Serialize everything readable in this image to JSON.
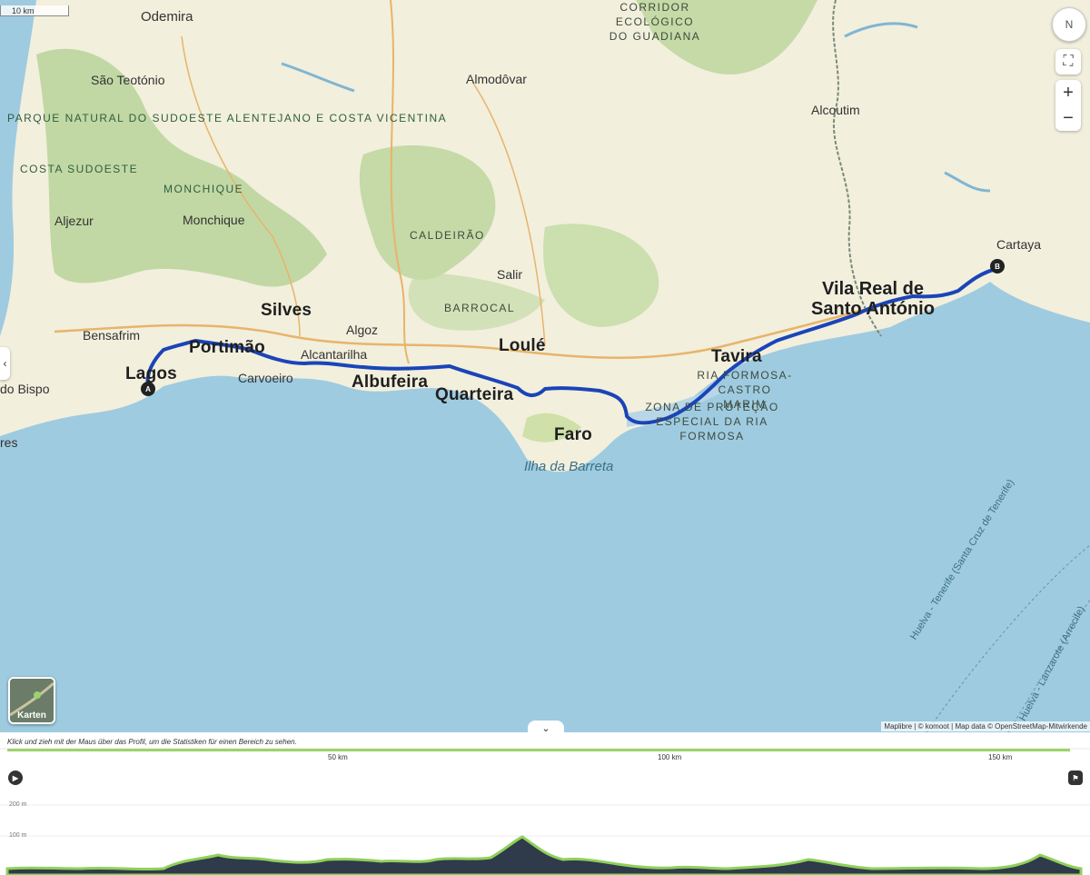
{
  "map": {
    "scale_label": "10 km",
    "compass_label": "N",
    "locate_icon": "locate-icon",
    "zoom_in_label": "+",
    "zoom_out_label": "−",
    "side_toggle_label": "‹",
    "layers_label": "Karten",
    "collapse_label": "⌄",
    "attribution": "Maplibre | © komoot | Map data © OpenStreetMap-Mitwirkende",
    "start_marker": "A",
    "end_marker": "B",
    "route_color": "#1a44b8",
    "sea_color": "#9ecbe0",
    "land_color": "#f2efdd",
    "forest_color": "#b9d49a",
    "labels": {
      "odemira": "Odemira",
      "sao_teotonio": "São Teotónio",
      "almodovar": "Almodôvar",
      "alcoutim": "Alcoutim",
      "parque_natural": "PARQUE NATURAL DO SUDOESTE ALENTEJANO E COSTA VICENTINA",
      "costa_sudoeste": "COSTA SUDOESTE",
      "monchique_range": "MONCHIQUE",
      "monchique": "Monchique",
      "aljezur": "Aljezur",
      "caldeirao": "CALDEIRÃO",
      "guadiana": "CORRIDOR ECOLÓGICO DO GUADIANA",
      "cartaya": "Cartaya",
      "silves": "Silves",
      "salir": "Salir",
      "barrocal": "BARROCAL",
      "vila_real": "Vila Real de Santo António",
      "bensafrim": "Bensafrim",
      "algoz": "Algoz",
      "loule": "Loulé",
      "tavira": "Tavira",
      "portimao": "Portimão",
      "alcantarilha": "Alcantarilha",
      "ria_formosa": "RIA FORMOSA-CASTRO MARIM",
      "lagos": "Lagos",
      "vila_do_bispo": "do Bispo",
      "carvoeiro": "Carvoeiro",
      "albufeira": "Albufeira",
      "quarteira": "Quarteira",
      "zona_protecao": "ZONA DE PROTEÇÃO ESPECIAL DA RIA FORMOSA",
      "faro": "Faro",
      "ilha_barreta": "Ilha da Barreta",
      "res": "res",
      "ferry1": "Huelva - Tenerife (Santa Cruz de Tenerife)",
      "ferry2": "Huelva - Lanzarote (Arrecife)"
    }
  },
  "profile": {
    "hint": "Klick und zieh mit der Maus über das Profil, um die Statistiken für einen Bereich zu sehen.",
    "ticks": [
      "50 km",
      "100 km",
      "150 km"
    ],
    "y_labels": [
      "200 m",
      "100 m"
    ],
    "play_icon": "play-icon",
    "finish_icon": "finish-flag-icon"
  }
}
